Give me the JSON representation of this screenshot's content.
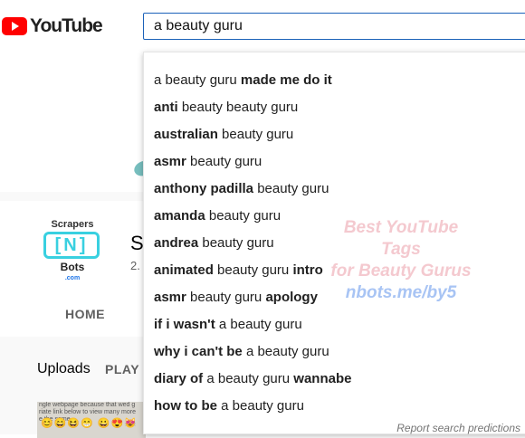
{
  "header": {
    "logo_text": "YouTube",
    "search_value": "a beauty guru"
  },
  "channel": {
    "avatar": {
      "top": "Scrapers",
      "letter": "[N]",
      "bottom": "Bots",
      "domain": ".com"
    },
    "name_initial": "S",
    "subs_partial": "2.",
    "tab_home": "HOME",
    "uploads_label": "Uploads",
    "play_all_label": "PLAY A",
    "thumb_text": "ngle webpage because that wed g\nriate link below to view many more\ne the same",
    "thumb_emoji": "😊😄😆😁 😀😍😻"
  },
  "watermark": {
    "line1": "Best YouTube Tags",
    "line2": "for Beauty Gurus",
    "line3": "nbots.me/by5"
  },
  "suggestions": [
    {
      "before": "a beauty guru",
      "bold": "made me do it",
      "after": ""
    },
    {
      "bold_pre": "anti",
      "text": "beauty beauty guru"
    },
    {
      "bold_pre": "australian",
      "text": "beauty guru"
    },
    {
      "bold_pre": "asmr",
      "text": "beauty guru"
    },
    {
      "bold_pre": "anthony padilla",
      "text": "beauty guru"
    },
    {
      "bold_pre": "amanda",
      "text": "beauty guru"
    },
    {
      "bold_pre": "andrea",
      "text": "beauty guru"
    },
    {
      "bold_pre": "animated",
      "text": "beauty guru",
      "bold_post": "intro"
    },
    {
      "bold_pre": "asmr",
      "text": "beauty guru",
      "bold_post": "apology"
    },
    {
      "bold_pre": "if i wasn't",
      "text": "a beauty guru"
    },
    {
      "bold_pre": "why i can't be",
      "text": "a beauty guru"
    },
    {
      "bold_pre": "diary of",
      "text": "a beauty guru",
      "bold_post": "wannabe"
    },
    {
      "bold_pre": "how to be",
      "text": "a beauty guru"
    }
  ],
  "report_label": "Report search predictions"
}
